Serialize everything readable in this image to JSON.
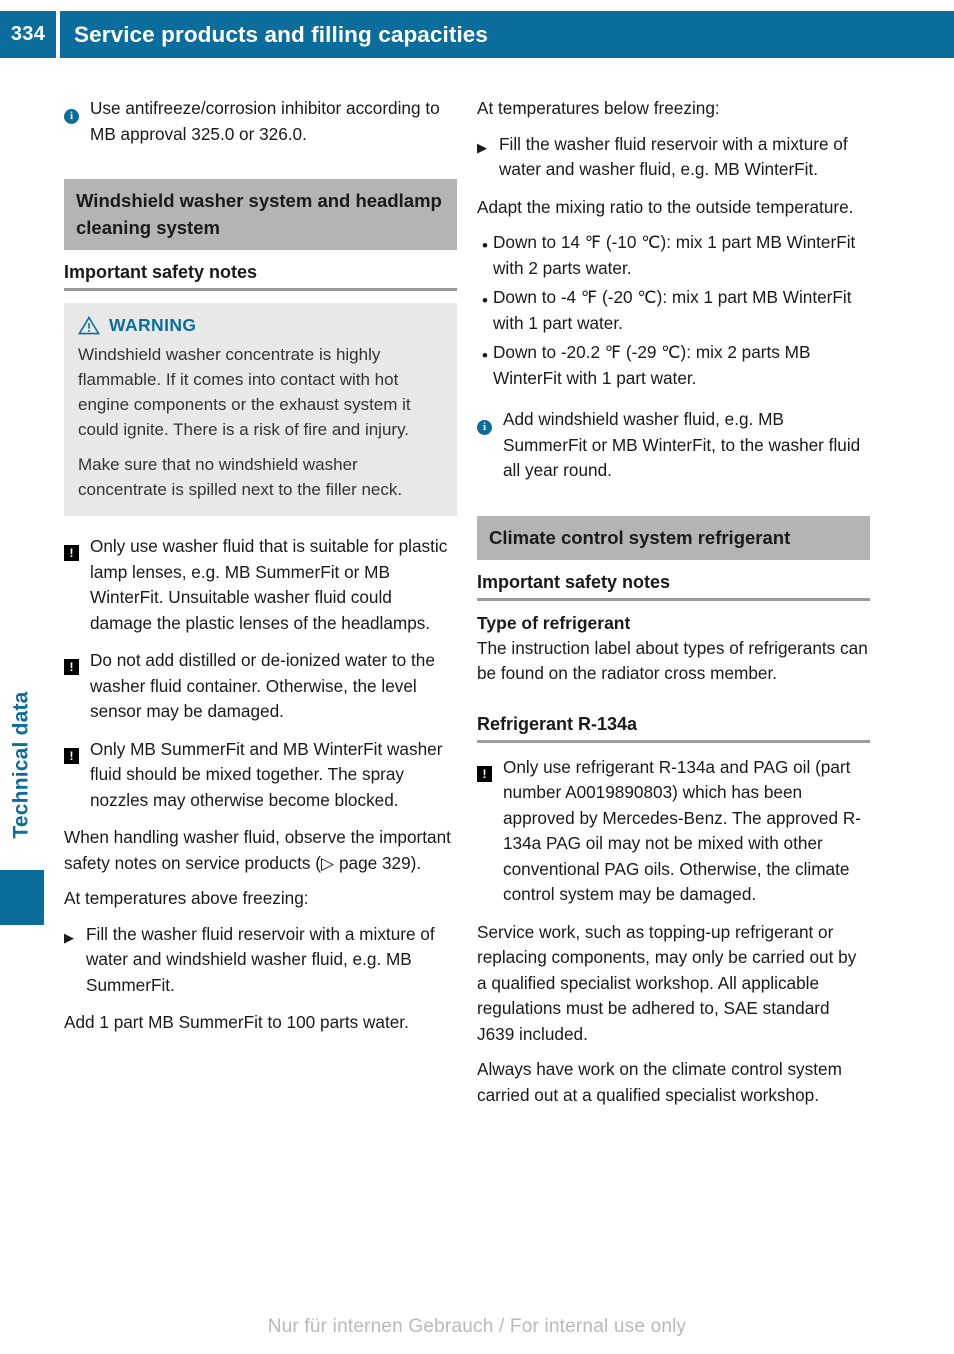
{
  "header": {
    "page_number": "334",
    "title": "Service products and filling capacities",
    "bar_color": "#0a6d9c"
  },
  "side_tab": {
    "label": "Technical data",
    "color": "#0a6d9c"
  },
  "footer": {
    "text": "Nur für internen Gebrauch / For internal use only"
  },
  "icons": {
    "info": "info-circle-icon",
    "caution": "caution-exclamation-icon",
    "step": "step-arrow-icon",
    "bullet": "bullet-dot-icon",
    "warning_triangle": "warning-triangle-icon",
    "info_glyph": "i",
    "caution_glyph": "!",
    "step_glyph": "▶",
    "bullet_glyph": "•"
  },
  "left_column": {
    "note_antifreeze": "Use antifreeze/corrosion inhibitor according to MB approval 325.0 or 326.0.",
    "section_title": "Windshield washer system and headlamp cleaning system",
    "safety_notes_heading": "Important safety notes",
    "warning": {
      "label": "WARNING",
      "paragraph_1": "Windshield washer concentrate is highly flammable. If it comes into contact with hot engine components or the exhaust system it could ignite. There is a risk of fire and injury.",
      "paragraph_2": "Make sure that no windshield washer concentrate is spilled next to the filler neck.",
      "accent_color": "#0a6d9c",
      "background_color": "#e8e8e8"
    },
    "caution_1": "Only use washer fluid that is suitable for plastic lamp lenses, e.g. MB SummerFit or MB WinterFit. Unsuitable washer fluid could damage the plastic lenses of the headlamps.",
    "caution_2": "Do not add distilled or de-ionized water to the washer fluid container. Otherwise, the level sensor may be damaged.",
    "caution_3": "Only MB SummerFit and MB WinterFit washer fluid should be mixed together. The spray nozzles may otherwise become blocked.",
    "handling_text": "When handling washer fluid, observe the important safety notes on service products (▷ page 329).",
    "above_freezing_intro": "At temperatures above freezing:",
    "step_above_freezing": "Fill the washer fluid reservoir with a mixture of water and windshield washer fluid, e.g. MB SummerFit.",
    "mixing_note": "Add 1 part MB SummerFit to 100 parts water."
  },
  "right_column": {
    "below_freezing_intro": "At temperatures below freezing:",
    "step_below_freezing": "Fill the washer fluid reservoir with a mixture of water and washer fluid, e.g. MB WinterFit.",
    "adapt_ratio": "Adapt the mixing ratio to the outside temperature.",
    "mix_ratios": [
      "Down to 14 ℉ (-10 ℃): mix 1 part MB WinterFit with 2 parts water.",
      "Down to -4 ℉ (-20 ℃): mix 1 part MB WinterFit with 1 part water.",
      "Down to -20.2 ℉ (-29 ℃): mix 2 parts MB WinterFit with 1 part water."
    ],
    "note_all_year": "Add windshield washer fluid, e.g. MB SummerFit or MB WinterFit, to the washer fluid all year round.",
    "section_title": "Climate control system refrigerant",
    "safety_notes_heading": "Important safety notes",
    "type_heading": "Type of refrigerant",
    "type_text": "The instruction label about types of refrigerants can be found on the radiator cross member.",
    "refrigerant_heading": "Refrigerant R-134a",
    "caution_refrigerant": "Only use refrigerant R-134a and PAG oil (part number A0019890803) which has been approved by Mercedes-Benz. The approved R-134a PAG oil may not be mixed with other conventional PAG oils. Otherwise, the climate control system may be damaged.",
    "service_work_text": "Service work, such as topping-up refrigerant or replacing components, may only be carried out by a qualified specialist workshop. All applicable regulations must be adhered to, SAE standard J639 included.",
    "workshop_text": "Always have work on the climate control system carried out at a qualified specialist workshop."
  }
}
